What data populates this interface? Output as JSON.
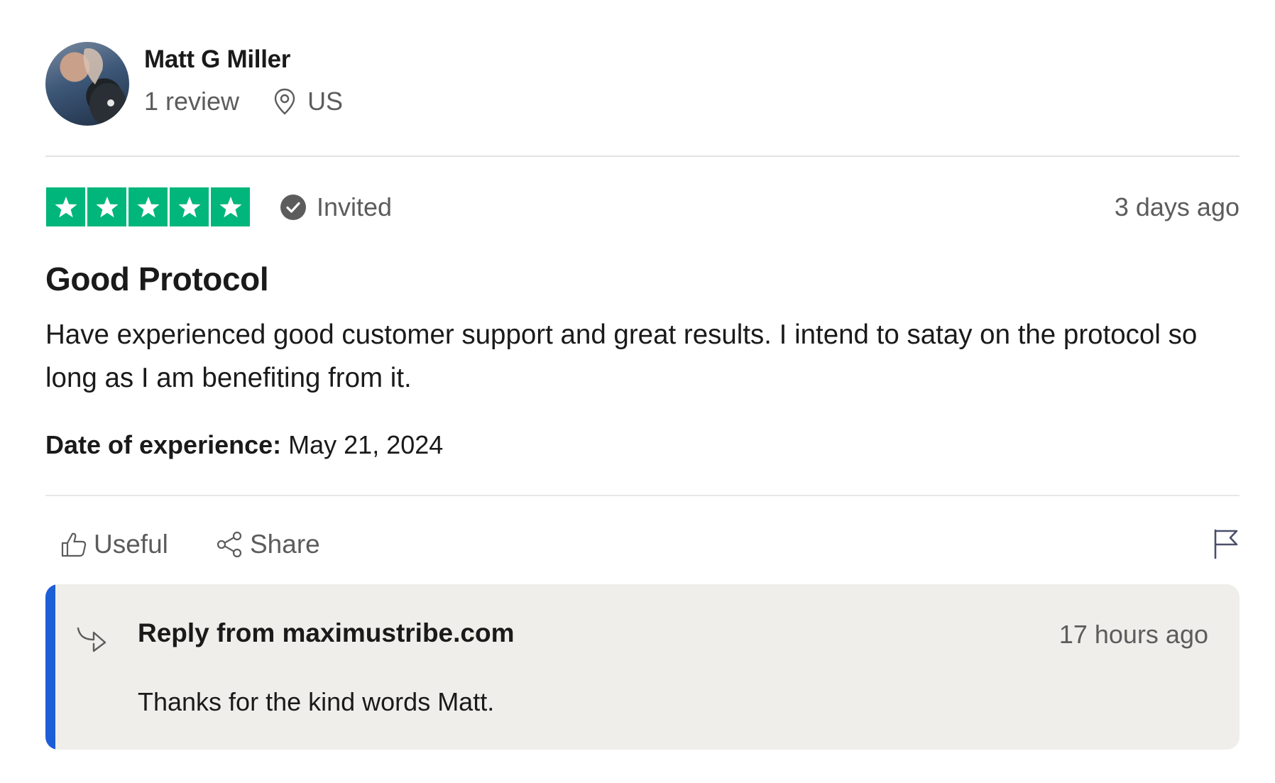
{
  "reviewer": {
    "name": "Matt G Miller",
    "review_count": "1 review",
    "location": "US"
  },
  "review": {
    "rating": 5,
    "rating_max": 5,
    "invited_label": "Invited",
    "posted_ago": "3 days ago",
    "title": "Good Protocol",
    "body": "Have experienced good customer support and great results. I intend to satay on the protocol so long as I am benefiting from it.",
    "experience_label": "Date of experience:",
    "experience_date": "May 21, 2024"
  },
  "actions": {
    "useful_label": "Useful",
    "share_label": "Share"
  },
  "reply": {
    "from": "Reply from maximustribe.com",
    "posted_ago": "17 hours ago",
    "text": "Thanks for the kind words Matt."
  },
  "colors": {
    "star_green": "#00b67a",
    "reply_accent": "#1c5ed6",
    "reply_background": "#efeeea"
  },
  "icons": [
    "location-pin-icon",
    "check-circle-icon",
    "thumbs-up-icon",
    "share-icon",
    "flag-icon",
    "reply-arrow-icon"
  ]
}
